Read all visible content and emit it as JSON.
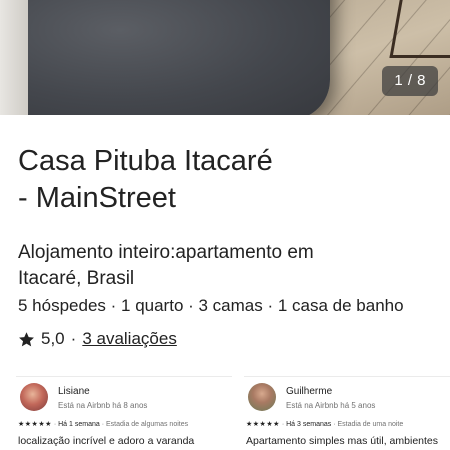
{
  "gallery": {
    "counter": "1 / 8"
  },
  "listing": {
    "title_line1": "Casa Pituba Itacaré",
    "title_line2": "- MainStreet",
    "subtitle_line1": "Alojamento inteiro:apartamento em",
    "subtitle_line2": "Itacaré, Brasil",
    "details": "5 hóspedes · 1 quarto · 3 camas · 1 casa de banho",
    "rating": "5,0",
    "separator": "·",
    "reviews_link": "3 avaliações"
  },
  "reviews": [
    {
      "name": "Lisiane",
      "since": "Está na Airbnb há 8 anos",
      "stars": "★★★★★",
      "when": "Há 1 semana",
      "stay": "Estadia de algumas noites",
      "text": "localização incrível e adoro a varanda"
    },
    {
      "name": "Guilherme",
      "since": "Está na Airbnb há 5 anos",
      "stars": "★★★★★",
      "when": "Há 3 semanas",
      "stay": "Estadia de uma noite",
      "text": "Apartamento simples mas útil, ambientes"
    }
  ],
  "icons": {
    "rating": "star-icon",
    "avatar": "avatar"
  },
  "colors": {
    "text": "#222222",
    "muted": "#717171",
    "counter_bg": "#3c3c3c"
  }
}
